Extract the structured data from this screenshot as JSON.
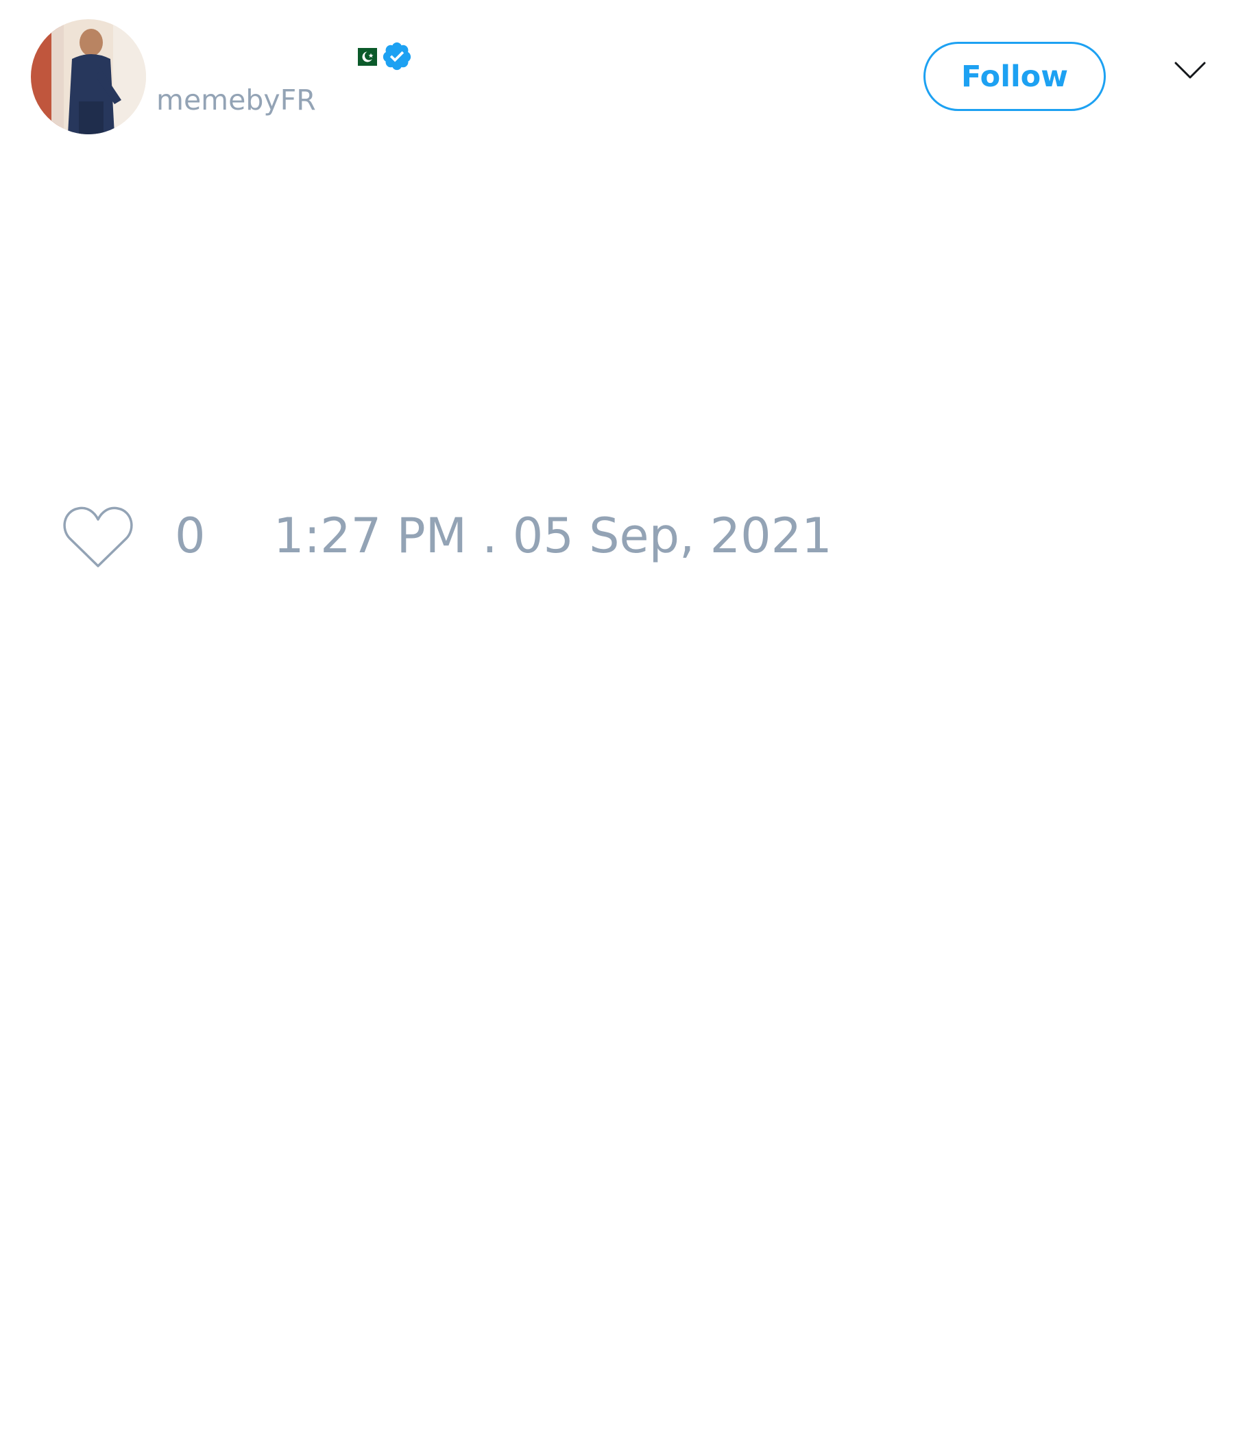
{
  "tweet": {
    "author": {
      "handle": "memebyFR",
      "flag_icon": "pakistan-flag-icon",
      "verified_icon": "verified-badge-icon"
    },
    "follow_label": "Follow",
    "menu_icon": "chevron-down-icon",
    "like_icon": "heart-icon",
    "like_count": "0",
    "timestamp": "1:27 PM . 05 Sep, 2021"
  },
  "colors": {
    "accent": "#1da1f2",
    "muted_text": "#93a3b5",
    "background": "#ffffff"
  }
}
